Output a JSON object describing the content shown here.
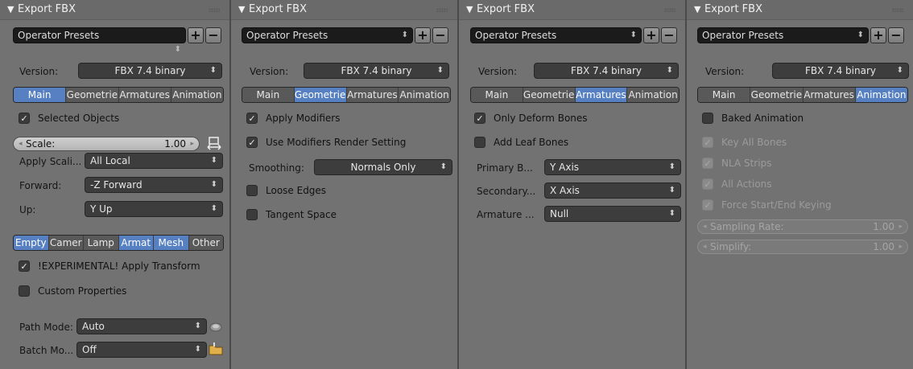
{
  "panels": [
    {
      "header": {
        "title": "Export FBX",
        "collapse_icon": "triangle-down-icon"
      },
      "presets": {
        "label": "Operator Presets"
      },
      "version": {
        "label": "Version:",
        "value": "FBX 7.4 binary"
      },
      "tabs": [
        "Main",
        "Geometrie",
        "Armatures",
        "Animation"
      ],
      "active_tab": "Main",
      "selected_objects": "Selected Objects",
      "scale": {
        "label": "Scale:",
        "value": "1.00"
      },
      "apply_scaling": {
        "label": "Apply Scali...",
        "value": "All Local"
      },
      "forward": {
        "label": "Forward:",
        "value": "-Z Forward"
      },
      "up": {
        "label": "Up:",
        "value": "Y Up"
      },
      "object_types": [
        {
          "label": "Empty",
          "active": true
        },
        {
          "label": "Camer",
          "active": false
        },
        {
          "label": "Lamp",
          "active": false
        },
        {
          "label": "Armat",
          "active": true
        },
        {
          "label": "Mesh",
          "active": true
        },
        {
          "label": "Other",
          "active": false
        }
      ],
      "experimental": "!EXPERIMENTAL! Apply Transform",
      "custom_properties": "Custom Properties",
      "path_mode": {
        "label": "Path Mode:",
        "value": "Auto"
      },
      "batch_mode": {
        "label": "Batch Mo...",
        "value": "Off"
      }
    },
    {
      "header": {
        "title": "Export FBX"
      },
      "presets": {
        "label": "Operator Presets"
      },
      "version": {
        "label": "Version:",
        "value": "FBX 7.4 binary"
      },
      "tabs": [
        "Main",
        "Geometrie",
        "Armatures",
        "Animation"
      ],
      "active_tab": "Geometrie",
      "apply_modifiers": "Apply Modifiers",
      "use_modifiers_render": "Use Modifiers Render Setting",
      "smoothing": {
        "label": "Smoothing:",
        "value": "Normals Only"
      },
      "loose_edges": "Loose Edges",
      "tangent_space": "Tangent Space"
    },
    {
      "header": {
        "title": "Export FBX"
      },
      "presets": {
        "label": "Operator Presets"
      },
      "version": {
        "label": "Version:",
        "value": "FBX 7.4 binary"
      },
      "tabs": [
        "Main",
        "Geometrie",
        "Armatures",
        "Animation"
      ],
      "active_tab": "Armatures",
      "only_deform_bones": "Only Deform Bones",
      "add_leaf_bones": "Add Leaf Bones",
      "primary_bone": {
        "label": "Primary B...",
        "value": "Y Axis"
      },
      "secondary_bone": {
        "label": "Secondary...",
        "value": "X Axis"
      },
      "armature_node": {
        "label": "Armature ...",
        "value": "Null"
      }
    },
    {
      "header": {
        "title": "Export FBX"
      },
      "presets": {
        "label": "Operator Presets"
      },
      "version": {
        "label": "Version:",
        "value": "FBX 7.4 binary"
      },
      "tabs": [
        "Main",
        "Geometrie",
        "Armatures",
        "Animation"
      ],
      "active_tab": "Animation",
      "baked_animation": "Baked Animation",
      "key_all_bones": "Key All Bones",
      "nla_strips": "NLA Strips",
      "all_actions": "All Actions",
      "force_keying": "Force Start/End Keying",
      "sampling_rate": {
        "label": "Sampling Rate:",
        "value": "1.00"
      },
      "simplify": {
        "label": "Simplify:",
        "value": "1.00"
      }
    }
  ],
  "colors": {
    "panel_bg": "#727272",
    "accent": "#5680c2",
    "field_bg": "#3d3d3d",
    "presets_bg": "#1b1b1b"
  }
}
